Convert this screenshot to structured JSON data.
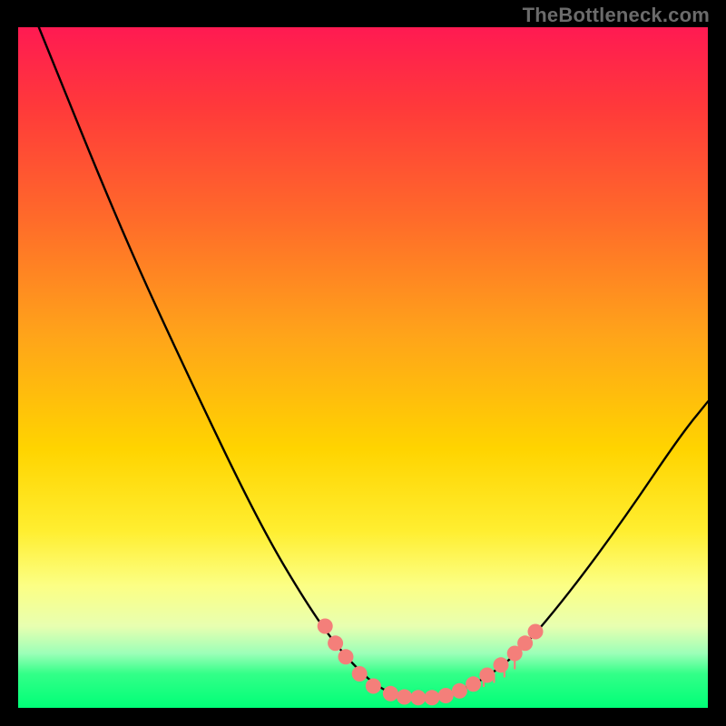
{
  "watermark": "TheBottleneck.com",
  "chart_data": {
    "type": "line",
    "title": "",
    "xlabel": "",
    "ylabel": "",
    "xlim": [
      0,
      100
    ],
    "ylim": [
      0,
      100
    ],
    "grid": false,
    "legend": false,
    "series": [
      {
        "name": "bottleneck-curve",
        "points": [
          {
            "x": 3,
            "y": 100
          },
          {
            "x": 15,
            "y": 70
          },
          {
            "x": 25,
            "y": 48
          },
          {
            "x": 35,
            "y": 27
          },
          {
            "x": 42,
            "y": 15
          },
          {
            "x": 47,
            "y": 8
          },
          {
            "x": 52,
            "y": 3
          },
          {
            "x": 56,
            "y": 1.5
          },
          {
            "x": 60,
            "y": 1.5
          },
          {
            "x": 64,
            "y": 2.5
          },
          {
            "x": 68,
            "y": 4.5
          },
          {
            "x": 73,
            "y": 8.5
          },
          {
            "x": 80,
            "y": 17
          },
          {
            "x": 88,
            "y": 28
          },
          {
            "x": 96,
            "y": 40
          },
          {
            "x": 100,
            "y": 45
          }
        ]
      }
    ],
    "markers": [
      {
        "x": 44.5,
        "y": 12.0
      },
      {
        "x": 46.0,
        "y": 9.5
      },
      {
        "x": 47.5,
        "y": 7.5
      },
      {
        "x": 49.5,
        "y": 5.0
      },
      {
        "x": 51.5,
        "y": 3.2
      },
      {
        "x": 54.0,
        "y": 2.1
      },
      {
        "x": 56.0,
        "y": 1.6
      },
      {
        "x": 58.0,
        "y": 1.5
      },
      {
        "x": 60.0,
        "y": 1.5
      },
      {
        "x": 62.0,
        "y": 1.8
      },
      {
        "x": 64.0,
        "y": 2.5
      },
      {
        "x": 66.0,
        "y": 3.5
      },
      {
        "x": 68.0,
        "y": 4.8
      },
      {
        "x": 70.0,
        "y": 6.3
      },
      {
        "x": 72.0,
        "y": 8.0
      },
      {
        "x": 73.5,
        "y": 9.5
      },
      {
        "x": 75.0,
        "y": 11.2
      }
    ],
    "ticks": [
      {
        "x": 67.5,
        "y0": 3.2,
        "y1": 4.2
      },
      {
        "x": 69.0,
        "y0": 3.8,
        "y1": 5.0
      },
      {
        "x": 70.5,
        "y0": 4.6,
        "y1": 6.2
      },
      {
        "x": 72.0,
        "y0": 5.8,
        "y1": 7.8
      }
    ]
  },
  "colors": {
    "marker": "#f47f7a",
    "curve": "#000000",
    "background_frame": "#000000"
  }
}
